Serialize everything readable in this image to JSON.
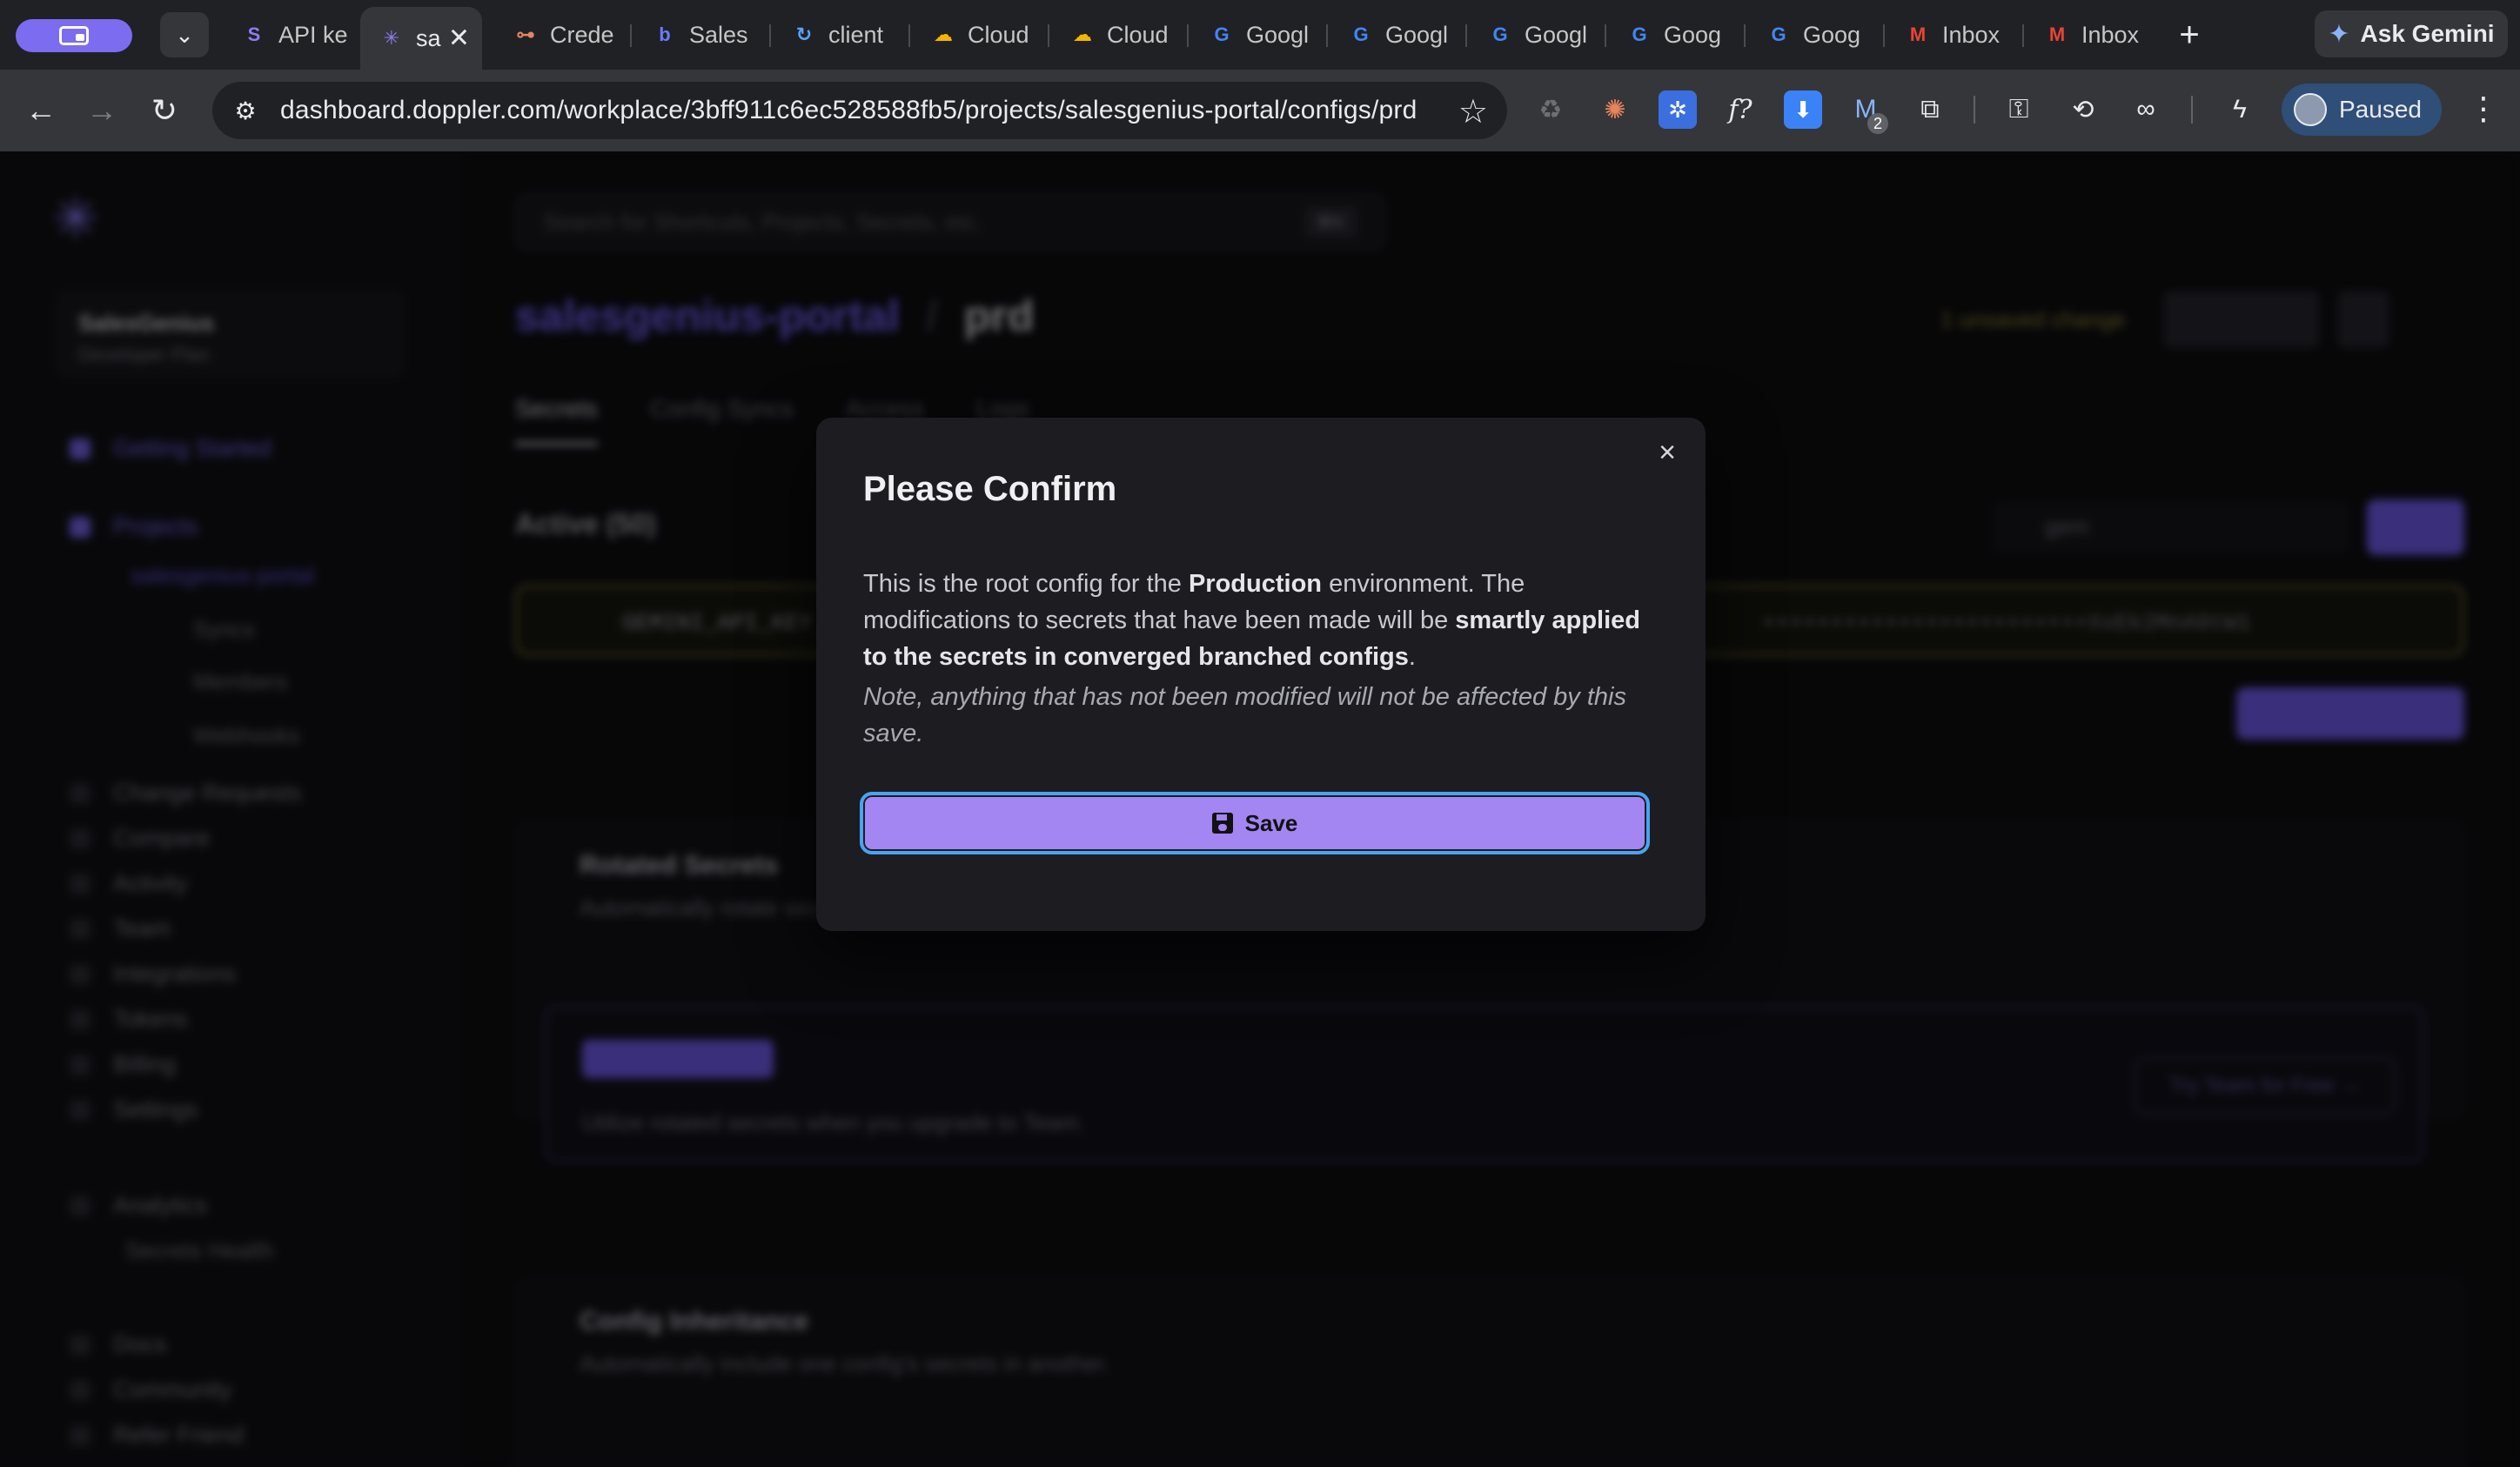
{
  "browser": {
    "tabs": [
      {
        "title": "API ke",
        "favicon": "ai-icon",
        "color": "#8e7cf3"
      },
      {
        "title": "sa",
        "favicon": "doppler-icon",
        "color": "#8e7cf3",
        "active": true
      },
      {
        "title": "Crede",
        "favicon": "credentials-icon",
        "color": "#e8845c"
      },
      {
        "title": "Sales",
        "favicon": "salesgenius-icon",
        "color": "#6b7cff"
      },
      {
        "title": "client",
        "favicon": "refresh-icon",
        "color": "#5aa3ff"
      },
      {
        "title": "Cloud",
        "favicon": "google-cloud-icon",
        "color": "#f4b400"
      },
      {
        "title": "Cloud",
        "favicon": "google-cloud-icon",
        "color": "#f4b400"
      },
      {
        "title": "Googl",
        "favicon": "google-icon",
        "color": "#4285f4"
      },
      {
        "title": "Googl",
        "favicon": "google-icon",
        "color": "#4285f4"
      },
      {
        "title": "Googl",
        "favicon": "google-icon",
        "color": "#4285f4"
      },
      {
        "title": "Goog",
        "favicon": "google-icon",
        "color": "#4285f4"
      },
      {
        "title": "Goog",
        "favicon": "google-icon",
        "color": "#4285f4"
      },
      {
        "title": "Inbox",
        "favicon": "gmail-icon",
        "color": "#ea4335"
      },
      {
        "title": "Inbox",
        "favicon": "gmail-icon",
        "color": "#ea4335"
      }
    ],
    "ask_gemini": "Ask Gemini",
    "url": "dashboard.doppler.com/workplace/3bff911c6ec528588fb5/projects/salesgenius-portal/configs/prd",
    "profile_status": "Paused",
    "extension_badge": "2"
  },
  "app": {
    "workspace": {
      "name": "SalesGenius",
      "plan": "Developer Plan"
    },
    "search_placeholder": "Search for Shortcuts, Projects, Secrets, etc.",
    "search_shortcut": "⌘K",
    "nav": [
      "Getting Started",
      "Projects",
      "Change Requests",
      "Compare",
      "Activity",
      "Team",
      "Integrations",
      "Tokens",
      "Billing",
      "Settings",
      "Analytics",
      "Docs",
      "Community",
      "Refer Friend"
    ],
    "nav_sub": [
      "salesgenius-portal",
      "Syncs",
      "Members",
      "Webhooks",
      "Secrets Health"
    ],
    "breadcrumb": {
      "project": "salesgenius-portal",
      "config": "prd"
    },
    "unsaved_label": "1 unsaved change",
    "tabs": [
      "Secrets",
      "Config Syncs",
      "Access",
      "Logs"
    ],
    "active_label": "Active (50)",
    "filter_value": "gem",
    "secret_row": {
      "key": "GEMINI_API_KEY",
      "value": "••••••••••••••••••••••••XxEk2MnA9tW1"
    },
    "rotated_card": {
      "title": "Rotated Secrets",
      "subtitle": "Automatically rotate secrets"
    },
    "team_badge": "Team Feature",
    "upgrade_text": "Utilize rotated secrets when you upgrade to Team.",
    "try_button": "Try Team for Free →",
    "inheritance_card": {
      "title": "Config Inheritance",
      "subtitle": "Automatically include one config's secrets in another."
    }
  },
  "modal": {
    "title": "Please Confirm",
    "body_pre": "This is the root config for the ",
    "body_env": "Production",
    "body_mid": " environment. The modifications to secrets that have been made will be ",
    "body_bold": "smartly applied to the secrets in converged branched configs",
    "body_end": ".",
    "note": "Note, anything that has not been modified will not be affected by this save.",
    "save_label": "Save",
    "close_label": "×"
  }
}
